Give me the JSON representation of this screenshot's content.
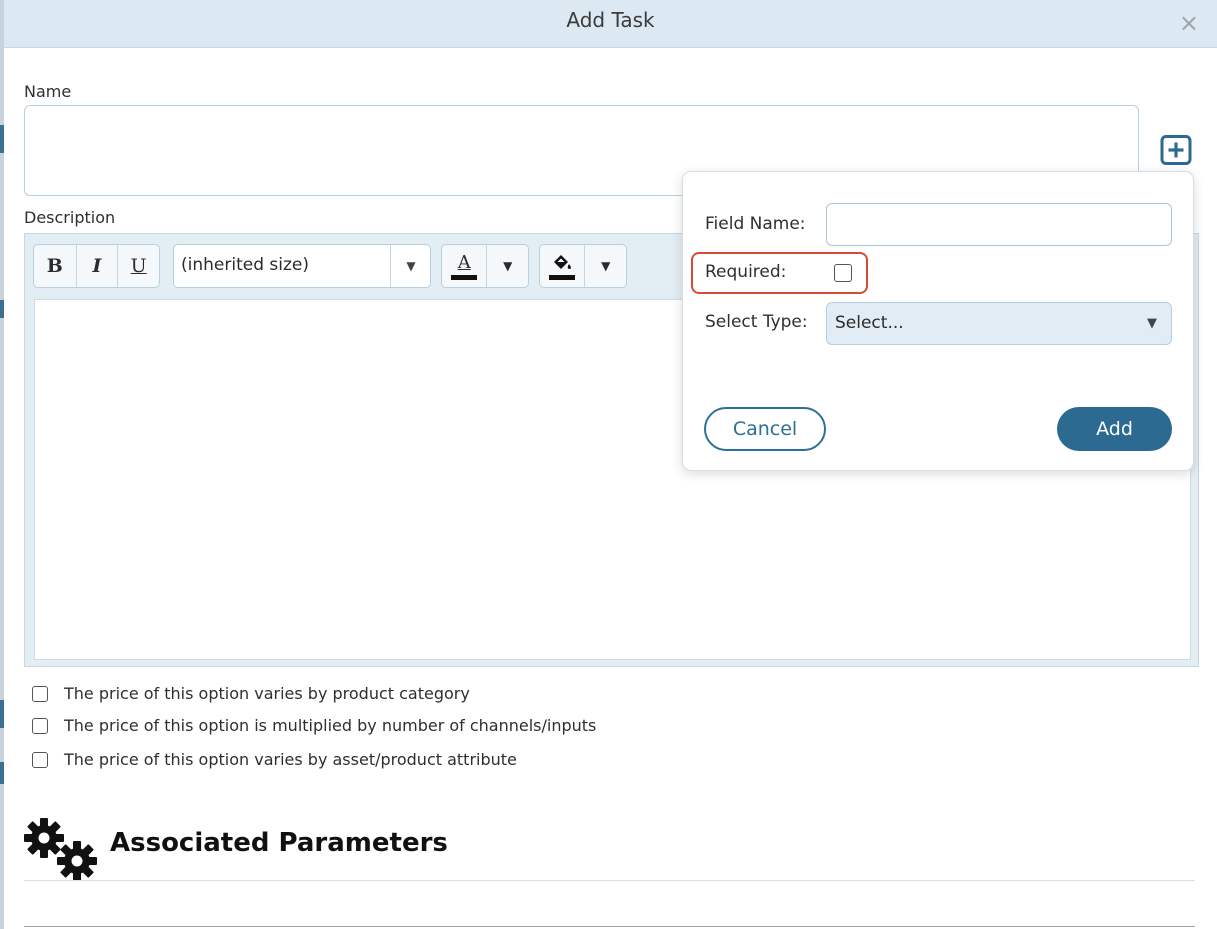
{
  "dialog": {
    "title": "Add Task",
    "close_glyph": "×"
  },
  "form": {
    "name_label": "Name",
    "name_value": "",
    "add_field_icon": "plus-square-icon",
    "description_label": "Description"
  },
  "toolbar": {
    "bold": "B",
    "italic": "I",
    "underline": "U",
    "font_size_value": "(inherited size)",
    "dropdown_glyph": "▼",
    "text_color_glyph": "A",
    "text_color": "#111111",
    "highlight_color": "#111111",
    "highlight_icon": "paint-bucket-icon"
  },
  "options": [
    {
      "label": "The price of this option varies by product category",
      "checked": false
    },
    {
      "label": "The price of this option is multiplied by number of channels/inputs",
      "checked": false
    },
    {
      "label": "The price of this option varies by asset/product attribute",
      "checked": false
    }
  ],
  "parameters": {
    "icon": "gears-icon",
    "title": "Associated Parameters"
  },
  "popover": {
    "field_name_label": "Field Name:",
    "field_name_value": "",
    "required_label": "Required:",
    "required_checked": false,
    "select_type_label": "Select Type:",
    "select_type_value": "Select...",
    "select_arrow": "▼",
    "cancel_label": "Cancel",
    "add_label": "Add"
  },
  "colors": {
    "accent": "#2d6a92",
    "title_bar": "#dde9f2",
    "highlight_border": "#d64a3a"
  }
}
